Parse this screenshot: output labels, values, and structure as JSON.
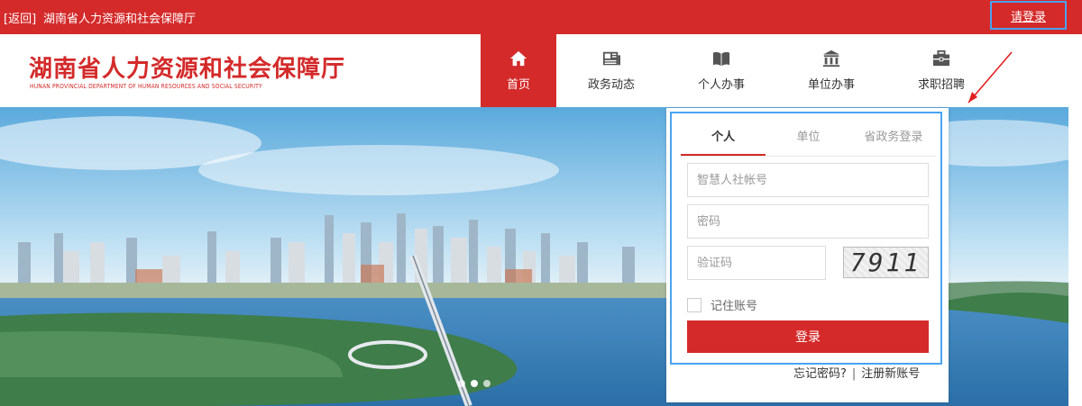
{
  "topbar": {
    "back_label": "[返回]",
    "site_title": "湖南省人力资源和社会保障厅",
    "login_link": "请登录"
  },
  "header": {
    "logo_cn": "湖南省人力资源和社会保障厅",
    "logo_en": "HUNAN PROVINCIAL DEPARTMENT OF HUMAN RESOURCES AND SOCIAL SECURITY"
  },
  "nav": {
    "items": [
      {
        "label": "首页",
        "icon": "home-icon"
      },
      {
        "label": "政务动态",
        "icon": "news-icon"
      },
      {
        "label": "个人办事",
        "icon": "book-icon"
      },
      {
        "label": "单位办事",
        "icon": "institution-icon"
      },
      {
        "label": "求职招聘",
        "icon": "briefcase-icon"
      }
    ],
    "active_index": 0
  },
  "login": {
    "tabs": [
      "个人",
      "单位",
      "省政务登录"
    ],
    "active_tab": 0,
    "account_placeholder": "智慧人社帐号",
    "password_placeholder": "密码",
    "captcha_placeholder": "验证码",
    "captcha_text": "7911",
    "remember_label": "记住账号",
    "login_button": "登录",
    "forgot_password": "忘记密码?",
    "separator": "|",
    "register": "注册新账号"
  },
  "colors": {
    "brand_red": "#d42a2a",
    "highlight_blue": "#4aa3f0"
  }
}
